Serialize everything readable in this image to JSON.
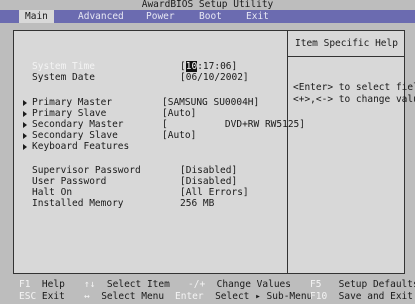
{
  "app": {
    "title": "AwardBIOS Setup Utility"
  },
  "menu": [
    "Main",
    "Advanced",
    "Power",
    "Boot",
    "Exit"
  ],
  "help": {
    "title": "Item Specific Help",
    "line1": "<Enter> to select field;",
    "line2": "<+>,<-> to change value."
  },
  "items": {
    "system_time": {
      "label": "System Time",
      "value_hl": "10",
      "value_rest": ":17:06]"
    },
    "system_date": {
      "label": "System Date",
      "value": "[06/10/2002]"
    },
    "primary_master": {
      "label": "Primary Master",
      "value": "[SAMSUNG SU0004H]"
    },
    "primary_slave": {
      "label": "Primary Slave",
      "value": "[Auto]"
    },
    "secondary_master": {
      "label": "Secondary Master",
      "value": "[          DVD+RW RW5125]"
    },
    "secondary_slave": {
      "label": "Secondary Slave",
      "value": "[Auto]"
    },
    "keyboard_features": {
      "label": "Keyboard Features"
    },
    "supervisor_password": {
      "label": "Supervisor Password",
      "value": "[Disabled]"
    },
    "user_password": {
      "label": "User Password",
      "value": "[Disabled]"
    },
    "halt_on": {
      "label": "Halt On",
      "value": "[All Errors]"
    },
    "installed_memory": {
      "label": "Installed Memory",
      "value": "256 MB"
    }
  },
  "footer": {
    "f1_key": "F1",
    "f1_label": "Help",
    "updown_key": "↑↓",
    "updown_label": "Select Item",
    "pm_key": "-/+",
    "pm_label": "Change Values",
    "f5_key": "F5",
    "f5_label": "Setup Defaults",
    "esc_key": "ESC",
    "esc_label": "Exit",
    "lr_key": "↔",
    "lr_label": "Select Menu",
    "enter_key": "Enter",
    "enter_label": "Select ▸ Sub-Menu",
    "f10_key": "F10",
    "f10_label": "Save and Exit"
  }
}
